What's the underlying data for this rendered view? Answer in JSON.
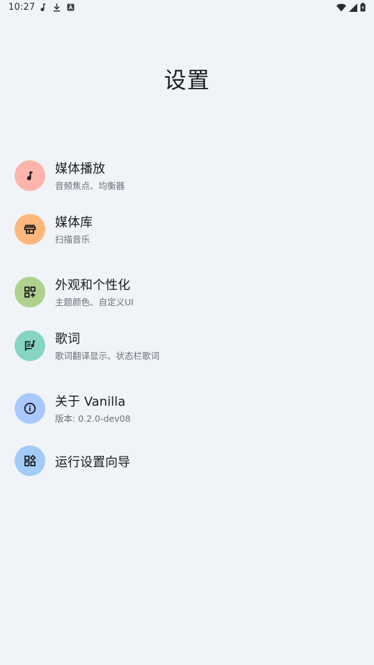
{
  "status_bar": {
    "time": "10:27",
    "left_icons": [
      "music-note-icon",
      "download-icon",
      "text-a-icon"
    ],
    "right_icons": [
      "wifi-icon",
      "signal-icon",
      "battery-charging-icon"
    ]
  },
  "page": {
    "title": "设置"
  },
  "settings": {
    "items": [
      {
        "title": "媒体播放",
        "subtitle": "音频焦点、均衡器",
        "icon": "music-note-icon",
        "icon_bg": "#FFB4AB"
      },
      {
        "title": "媒体库",
        "subtitle": "扫描音乐",
        "icon": "storefront-icon",
        "icon_bg": "#FFB77C"
      },
      {
        "title": "外观和个性化",
        "subtitle": "主题颜色、自定义UI",
        "icon": "dashboard-customize-icon",
        "icon_bg": "#AED18D"
      },
      {
        "title": "歌词",
        "subtitle": "歌词翻译显示、状态栏歌词",
        "icon": "lyrics-icon",
        "icon_bg": "#86D5C4"
      },
      {
        "title": "关于 Vanilla",
        "subtitle": "版本: 0.2.0-dev08",
        "icon": "info-icon",
        "icon_bg": "#A8C8FF"
      },
      {
        "title": "运行设置向导",
        "subtitle": "",
        "icon": "widgets-icon",
        "icon_bg": "#A2CBF8"
      }
    ]
  },
  "colors": {
    "background": "#F0F4F8",
    "text_primary": "#1B1C1F",
    "text_secondary": "#6B6F76"
  }
}
